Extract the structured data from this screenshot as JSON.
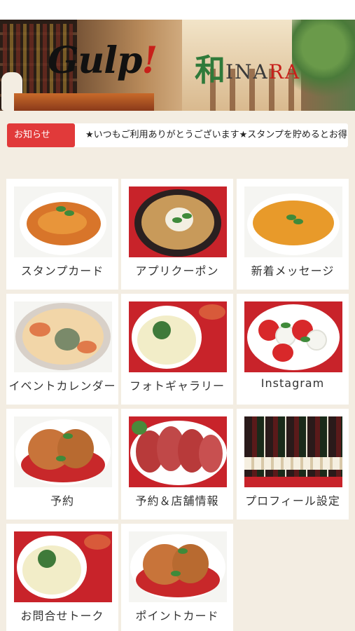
{
  "header": {
    "logo_gulp": "Gulp",
    "logo_gulp_mark": "!",
    "logo_wa": "和",
    "logo_inara_a": "INA",
    "logo_inara_b": "RA"
  },
  "news": {
    "label": "お知らせ",
    "text": "★いつもご利用ありがとうございます★スタンプを貯めるとお得な特典"
  },
  "menu": [
    {
      "label": "スタンプカード",
      "icon": "pasta-photo"
    },
    {
      "label": "アプリクーポン",
      "icon": "claypot-photo"
    },
    {
      "label": "新着メッセージ",
      "icon": "soup-photo"
    },
    {
      "label": "イベントカレンダー",
      "icon": "gratin-photo"
    },
    {
      "label": "フォトギャラリー",
      "icon": "fondue-photo"
    },
    {
      "label": "Instagram",
      "icon": "caprese-photo"
    },
    {
      "label": "予約",
      "icon": "croquette-photo"
    },
    {
      "label": "予約＆店舗情報",
      "icon": "roast-beef-photo"
    },
    {
      "label": "プロフィール設定",
      "icon": "wine-bottles-photo"
    },
    {
      "label": "お問合せトーク",
      "icon": "fondue-photo"
    },
    {
      "label": "ポイントカード",
      "icon": "croquette-photo"
    }
  ],
  "colors": {
    "accent": "#e13a3a",
    "background": "#f3ede2"
  }
}
